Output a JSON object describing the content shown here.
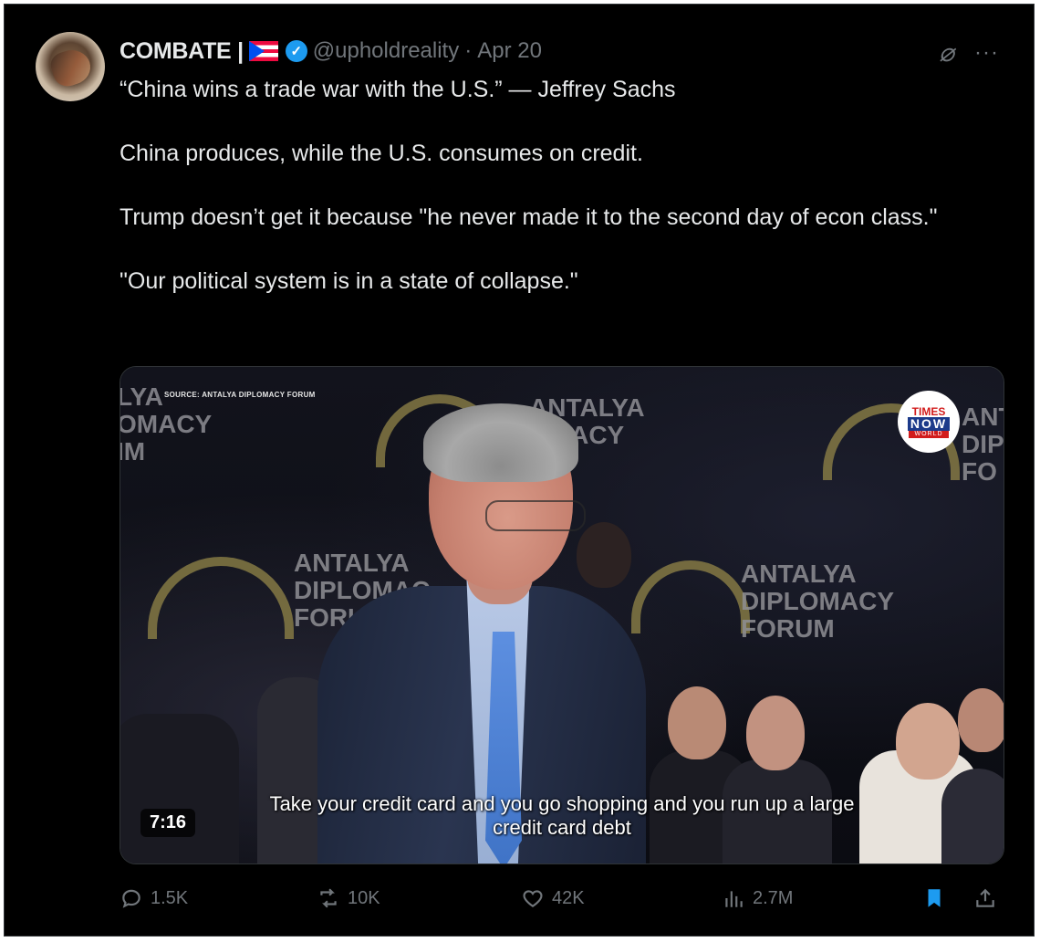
{
  "author": {
    "name": "COMBATE |",
    "handle": "@upholdreality",
    "separator": "·",
    "date": "Apr 20"
  },
  "tweet": {
    "paragraphs": [
      "“China wins a trade war with the U.S.” — Jeffrey Sachs",
      "China produces, while the U.S. consumes on credit.",
      "Trump doesn’t get it because \"he never made it to the second day of econ class.\"",
      "\"Our political system is in a state of collapse.\""
    ]
  },
  "video": {
    "source_label": "SOURCE: ANTALYA DIPLOMACY FORUM",
    "bg_text_left": "LYA\nOMACY\nIM",
    "bg_text_top": "ANTALYA\nOMACY\nUM",
    "bg_text_mid": "ANTALYA\nDIPLOMAC\nFORU",
    "bg_text_right": "ANTALYA\nDIPLOMACY\nFORUM",
    "bg_text_edge": "ANT\nDIP\nFO",
    "badge_line1": "TIMES",
    "badge_line2": "NOW",
    "badge_line3": "WORLD",
    "subtitle_line1": "Take your credit card and you go shopping and you run up a large",
    "subtitle_line2": "credit card debt",
    "duration": "7:16"
  },
  "actions": {
    "replies": "1.5K",
    "reposts": "10K",
    "likes": "42K",
    "views": "2.7M"
  },
  "icons": [
    "grok-icon",
    "more-icon",
    "reply-icon",
    "repost-icon",
    "like-icon",
    "views-icon",
    "bookmark-icon",
    "share-icon",
    "verified-icon",
    "flag-icon"
  ],
  "colors": {
    "background": "#000000",
    "text": "#e7e9ea",
    "secondary": "#71767b",
    "verified": "#1d9bf0",
    "bookmark": "#1d9bf0"
  }
}
